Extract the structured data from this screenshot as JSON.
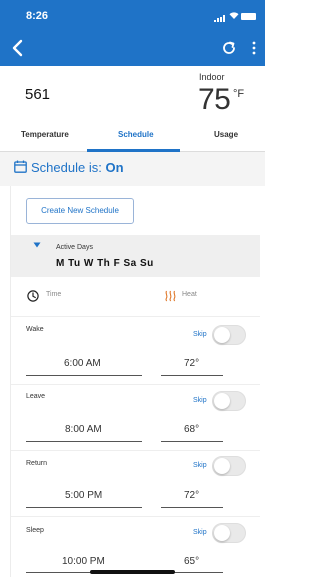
{
  "status_bar": {
    "time": "8:26"
  },
  "colors": {
    "brand_blue": "#1f73c7",
    "tab_active": "#1f73c7",
    "toggle_off": "#e9e9e9"
  },
  "icons": {
    "back": "chevron-left-icon",
    "refresh": "refresh-icon",
    "more": "more-vertical-icon",
    "schedule": "calendar-icon",
    "active_days_toggle": "caret-down-icon",
    "time_column": "clock-icon",
    "heat_column": "heat-waves-icon"
  },
  "thermostat": {
    "setpoint": "561",
    "indoor_label": "Indoor",
    "indoor_temp": "75",
    "indoor_unit": "°F"
  },
  "tabs": [
    {
      "label": "Temperature",
      "active": false
    },
    {
      "label": "Schedule",
      "active": true
    },
    {
      "label": "Usage",
      "active": false
    }
  ],
  "schedule": {
    "status_prefix": "Schedule is:",
    "status_value": "On",
    "create_button": "Create New Schedule",
    "active_days_label": "Active Days",
    "active_days_value": "M Tu W Th F Sa Su",
    "columns": {
      "time": "Time",
      "heat": "Heat"
    },
    "periods": [
      {
        "name": "Wake",
        "skip": "Skip",
        "skip_on": false,
        "time": "6:00 AM",
        "temp": "72°"
      },
      {
        "name": "Leave",
        "skip": "Skip",
        "skip_on": false,
        "time": "8:00 AM",
        "temp": "68°"
      },
      {
        "name": "Return",
        "skip": "Skip",
        "skip_on": false,
        "time": "5:00 PM",
        "temp": "72°"
      },
      {
        "name": "Sleep",
        "skip": "Skip",
        "skip_on": false,
        "time": "10:00 PM",
        "temp": "65°"
      }
    ]
  }
}
